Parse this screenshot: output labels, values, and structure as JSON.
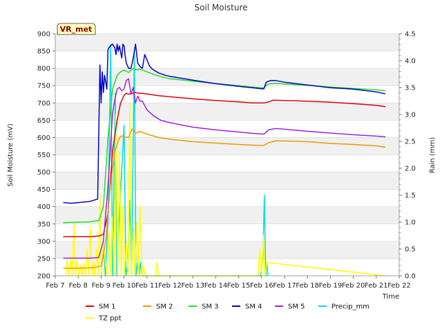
{
  "chart_data": {
    "type": "line",
    "title": "Soil Moisture",
    "badge": "VR_met",
    "xlabel": "Time",
    "ylabel": "Soil Moisture (mV)",
    "y2label": "Rain (mm)",
    "xlim": [
      7,
      22
    ],
    "ylim": [
      200,
      900
    ],
    "y2lim": [
      0,
      4.5
    ],
    "x_ticks": [
      7,
      8,
      9,
      10,
      11,
      12,
      13,
      14,
      15,
      16,
      17,
      18,
      19,
      20,
      21,
      22
    ],
    "x_tick_labels": [
      "Feb 7",
      "Feb 8",
      "Feb 9",
      "Feb 10",
      "Feb 11",
      "Feb 12",
      "Feb 13",
      "Feb 14",
      "Feb 15",
      "Feb 16",
      "Feb 17",
      "Feb 18",
      "Feb 19",
      "Feb 20",
      "Feb 21",
      "Feb 22"
    ],
    "y_ticks": [
      200,
      250,
      300,
      350,
      400,
      450,
      500,
      550,
      600,
      650,
      700,
      750,
      800,
      850,
      900
    ],
    "y2_ticks": [
      0.0,
      0.5,
      1.0,
      1.5,
      2.0,
      2.5,
      3.0,
      3.5,
      4.0,
      4.5
    ],
    "y2_tick_labels": [
      "0.0",
      "0.5",
      "1.0",
      "1.5",
      "2.0",
      "2.5",
      "3.0",
      "3.5",
      "4.0",
      "4.5"
    ],
    "grid": true,
    "legend_position": "bottom",
    "series": [
      {
        "name": "SM 1",
        "color": "#dd0000",
        "axis": "left",
        "x": [
          7.35,
          8.0,
          8.5,
          8.9,
          9.1,
          9.3,
          9.5,
          9.7,
          9.85,
          10.0,
          10.1,
          10.2,
          10.35,
          10.5,
          10.6,
          10.8,
          11.0,
          11.5,
          12,
          13,
          14,
          15,
          15.6,
          16.0,
          16.1,
          16.3,
          16.5,
          17,
          18,
          19,
          20,
          21,
          21.4
        ],
        "y": [
          313,
          313,
          313,
          315,
          320,
          380,
          560,
          650,
          700,
          722,
          728,
          725,
          728,
          730,
          728,
          728,
          726,
          721,
          718,
          712,
          707,
          703,
          700,
          700,
          700,
          703,
          708,
          707,
          705,
          702,
          698,
          693,
          689
        ]
      },
      {
        "name": "SM 2",
        "color": "#ee9900",
        "axis": "left",
        "x": [
          7.35,
          8.0,
          8.5,
          9.0,
          9.2,
          9.4,
          9.6,
          9.8,
          9.9,
          10.0,
          10.2,
          10.35,
          10.5,
          10.7,
          11.0,
          11.5,
          12,
          13,
          14,
          15,
          16.0,
          16.1,
          16.3,
          16.6,
          17,
          18,
          19,
          20,
          21,
          21.4
        ],
        "y": [
          222,
          222,
          223,
          228,
          300,
          460,
          560,
          600,
          605,
          602,
          600,
          625,
          612,
          618,
          610,
          600,
          595,
          588,
          584,
          580,
          577,
          577,
          585,
          590,
          590,
          588,
          583,
          580,
          576,
          572
        ]
      },
      {
        "name": "SM 3",
        "color": "#22dd22",
        "axis": "left",
        "x": [
          7.35,
          8.0,
          8.5,
          8.9,
          9.1,
          9.3,
          9.5,
          9.7,
          9.85,
          10.0,
          10.1,
          10.2,
          10.3,
          10.4,
          10.5,
          10.7,
          11.0,
          11.5,
          12,
          13,
          14,
          15,
          15.6,
          16.0,
          16.1,
          16.3,
          16.6,
          17,
          18,
          19,
          20,
          21,
          21.4
        ],
        "y": [
          354,
          355,
          356,
          360,
          400,
          600,
          740,
          780,
          790,
          795,
          792,
          788,
          795,
          800,
          796,
          798,
          790,
          778,
          770,
          763,
          756,
          750,
          746,
          744,
          744,
          755,
          757,
          755,
          751,
          746,
          742,
          738,
          735
        ]
      },
      {
        "name": "SM 4",
        "color": "#0000cc",
        "axis": "left",
        "x": [
          7.35,
          7.7,
          8.0,
          8.5,
          8.85,
          8.95,
          9.0,
          9.05,
          9.1,
          9.15,
          9.2,
          9.25,
          9.3,
          9.4,
          9.5,
          9.6,
          9.65,
          9.7,
          9.75,
          9.8,
          9.9,
          9.95,
          10.0,
          10.05,
          10.1,
          10.15,
          10.2,
          10.3,
          10.4,
          10.5,
          10.6,
          10.7,
          10.8,
          10.9,
          11.0,
          11.1,
          11.2,
          11.3,
          11.5,
          11.8,
          12,
          13,
          14,
          15,
          15.6,
          16.0,
          16.1,
          16.2,
          16.4,
          16.6,
          17,
          18,
          19,
          20,
          21,
          21.4
        ],
        "y": [
          412,
          410,
          412,
          415,
          422,
          810,
          700,
          790,
          730,
          780,
          760,
          740,
          855,
          865,
          870,
          860,
          840,
          870,
          850,
          865,
          830,
          870,
          865,
          835,
          815,
          808,
          800,
          800,
          830,
          870,
          815,
          805,
          800,
          840,
          825,
          808,
          800,
          795,
          787,
          780,
          777,
          766,
          756,
          748,
          744,
          741,
          741,
          760,
          765,
          765,
          760,
          752,
          744,
          740,
          732,
          726
        ]
      },
      {
        "name": "SM 5",
        "color": "#9922dd",
        "axis": "left",
        "x": [
          7.35,
          8.0,
          8.5,
          8.9,
          9.1,
          9.3,
          9.5,
          9.6,
          9.7,
          9.8,
          9.9,
          10.0,
          10.1,
          10.2,
          10.3,
          10.4,
          10.5,
          10.6,
          10.7,
          10.8,
          11.0,
          11.3,
          11.6,
          12,
          13,
          14,
          15,
          15.6,
          16.0,
          16.1,
          16.3,
          16.6,
          17,
          18,
          19,
          20,
          21,
          21.4
        ],
        "y": [
          251,
          251,
          251,
          253,
          300,
          460,
          670,
          710,
          740,
          745,
          735,
          740,
          765,
          770,
          725,
          745,
          700,
          720,
          705,
          705,
          680,
          662,
          650,
          643,
          630,
          622,
          616,
          612,
          610,
          610,
          622,
          626,
          624,
          618,
          613,
          608,
          604,
          602
        ]
      },
      {
        "name": "Precip_mm",
        "color": "#00dddd",
        "axis": "right",
        "x": [
          9.0,
          9.12,
          9.18,
          9.3,
          9.42,
          9.5,
          9.62,
          9.68,
          9.82,
          10.0,
          10.08,
          10.16,
          10.25,
          10.33,
          10.45,
          10.52,
          10.6,
          10.65,
          10.72,
          10.78,
          15.95,
          16.05,
          16.12,
          16.18,
          16.22,
          16.28
        ],
        "y": [
          0,
          0.5,
          0,
          1.0,
          4.3,
          0,
          3.4,
          0,
          1.3,
          2.8,
          0,
          0.2,
          1.4,
          0,
          4.2,
          0,
          0.25,
          0,
          0.25,
          0,
          0,
          0.3,
          1.5,
          0,
          0.25,
          0
        ]
      },
      {
        "name": "TZ ppt",
        "color": "#ffff00",
        "axis": "right",
        "x": [
          7.45,
          7.52,
          7.6,
          7.66,
          7.74,
          7.82,
          7.88,
          7.95,
          8.03,
          8.1,
          8.17,
          8.24,
          8.32,
          8.38,
          8.46,
          8.54,
          8.6,
          8.66,
          8.72,
          8.8,
          8.88,
          8.95,
          9.02,
          9.1,
          9.18,
          9.25,
          9.33,
          9.4,
          9.48,
          9.56,
          9.64,
          9.72,
          9.8,
          9.88,
          9.95,
          10.02,
          10.1,
          10.18,
          10.25,
          10.33,
          10.4,
          10.48,
          10.56,
          10.63,
          10.7,
          10.78,
          10.85,
          10.92,
          11.38,
          11.44,
          11.5,
          15.85,
          15.92,
          16.0,
          16.08,
          16.15,
          16.22,
          21.4
        ],
        "y": [
          0,
          0.3,
          0,
          0.3,
          0,
          1.0,
          0,
          0.3,
          0,
          0.2,
          0,
          0.25,
          0,
          0.5,
          0,
          0.9,
          0,
          0.3,
          0,
          0.5,
          0,
          1.5,
          0,
          0.6,
          0.3,
          0,
          0.8,
          0,
          1.1,
          0,
          3.0,
          0,
          2.3,
          0,
          1.3,
          0,
          0.6,
          0,
          3.2,
          0,
          0.9,
          0,
          1.0,
          0,
          1.3,
          0,
          0.2,
          0,
          0,
          0.25,
          0,
          0,
          0.5,
          0,
          0.75,
          0,
          0.25,
          0
        ]
      }
    ]
  }
}
